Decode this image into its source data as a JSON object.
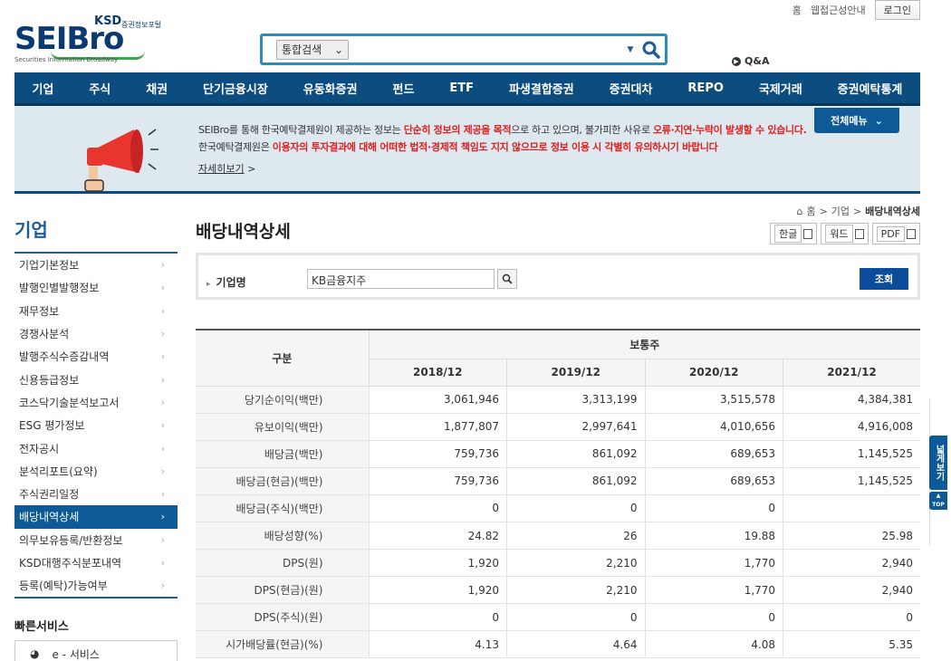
{
  "util": {
    "home": "홈",
    "accessibility": "웹접근성안내",
    "login": "로그인"
  },
  "logo": {
    "main": "SEIBro",
    "ksd": "KSD",
    "portal": "증권정보포털",
    "tagline": "Securities Information Broadway"
  },
  "search": {
    "scope": "통합검색",
    "query": ""
  },
  "qa": "Q&A",
  "nav": [
    "기업",
    "주식",
    "채권",
    "단기금융시장",
    "유동화증권",
    "펀드",
    "ETF",
    "파생결합증권",
    "증권대차",
    "REPO",
    "국제거래",
    "증권예탁통계"
  ],
  "banner": {
    "line1_a": "SEIBro를 통해 한국예탁결제원이 제공하는 정보는 ",
    "line1_b": "단순히 정보의 제공을 목적",
    "line1_c": "으로 하고 있으며, 불가피한 사유로 ",
    "line1_d": "오류·지연·누락이 발생할 수 있습니다.",
    "line2_a": "한국예탁결제원은 ",
    "line2_b": "이용자의 투자결과에 대해 어떠한 법적·경제적 책임도 지지 않으므로 정보 이용 시 각별히 유의하시기 바랍니다",
    "more": "자세히보기",
    "all_menu": "전체메뉴"
  },
  "breadcrumb": {
    "home": "홈",
    "level1": "기업",
    "current": "배당내역상세"
  },
  "sidebar": {
    "title": "기업",
    "items": [
      "기업기본정보",
      "발행인별발행정보",
      "재무정보",
      "경쟁사분석",
      "발행주식수증감내역",
      "신용등급정보",
      "코스닥기술분석보고서",
      "ESG 평가정보",
      "전자공시",
      "분석리포트(요약)",
      "주식권리일정",
      "배당내역상세",
      "의무보유등록/반환정보",
      "KSD대행주식분포내역",
      "등록(예탁)가능여부"
    ],
    "active_index": 11,
    "quick_title": "빠른서비스",
    "quick_item": "e - 서비스"
  },
  "page_title": "배당내역상세",
  "export": {
    "hwp": "한글",
    "word": "워드",
    "pdf": "PDF"
  },
  "filter": {
    "label": "기업명",
    "value": "KB금융지주",
    "submit": "조회"
  },
  "table": {
    "col_label": "구분",
    "group": "보통주",
    "years": [
      "2018/12",
      "2019/12",
      "2020/12",
      "2021/12"
    ],
    "rows": [
      {
        "label": "당기순이익(백만)",
        "values": [
          "3,061,946",
          "3,313,199",
          "3,515,578",
          "4,384,381"
        ]
      },
      {
        "label": "유보이익(백만)",
        "values": [
          "1,877,807",
          "2,997,641",
          "4,010,656",
          "4,916,008"
        ]
      },
      {
        "label": "배당금(백만)",
        "values": [
          "759,736",
          "861,092",
          "689,653",
          "1,145,525"
        ]
      },
      {
        "label": "배당금(현금)(백만)",
        "values": [
          "759,736",
          "861,092",
          "689,653",
          "1,145,525"
        ]
      },
      {
        "label": "배당금(주식)(백만)",
        "values": [
          "0",
          "0",
          "0",
          ""
        ]
      },
      {
        "label": "배당성향(%)",
        "values": [
          "24.82",
          "26",
          "19.88",
          "25.98"
        ]
      },
      {
        "label": "DPS(원)",
        "values": [
          "1,920",
          "2,210",
          "1,770",
          "2,940"
        ]
      },
      {
        "label": "DPS(현금)(원)",
        "values": [
          "1,920",
          "2,210",
          "1,770",
          "2,940"
        ]
      },
      {
        "label": "DPS(주식)(원)",
        "values": [
          "0",
          "0",
          "0",
          "0"
        ]
      },
      {
        "label": "시가배당률(현금)(%)",
        "values": [
          "4.13",
          "4.64",
          "4.08",
          "5.35"
        ]
      }
    ]
  },
  "right_tabs": {
    "wide": "넓게보기",
    "top": "TOP"
  }
}
